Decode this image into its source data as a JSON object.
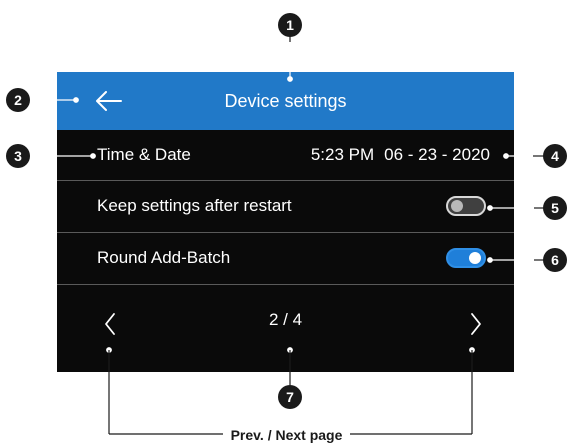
{
  "header": {
    "title": "Device settings",
    "back_icon": "arrow-left-icon",
    "color": "#2179c8"
  },
  "settings": {
    "time_date": {
      "label": "Time & Date",
      "time": "5:23 PM",
      "date": "06 - 23 - 2020"
    },
    "keep_settings": {
      "label": "Keep settings after restart",
      "enabled": false
    },
    "round_add_batch": {
      "label": "Round Add-Batch",
      "enabled": true
    }
  },
  "pager": {
    "indicator": "2 / 4",
    "prev_icon": "chevron-left-icon",
    "next_icon": "chevron-right-icon"
  },
  "callouts": [
    "1",
    "2",
    "3",
    "4",
    "5",
    "6",
    "7"
  ],
  "caption": "Prev. / Next page",
  "colors": {
    "toggle_on": "#1f7fd9",
    "screen_bg": "#0a0a0a"
  }
}
